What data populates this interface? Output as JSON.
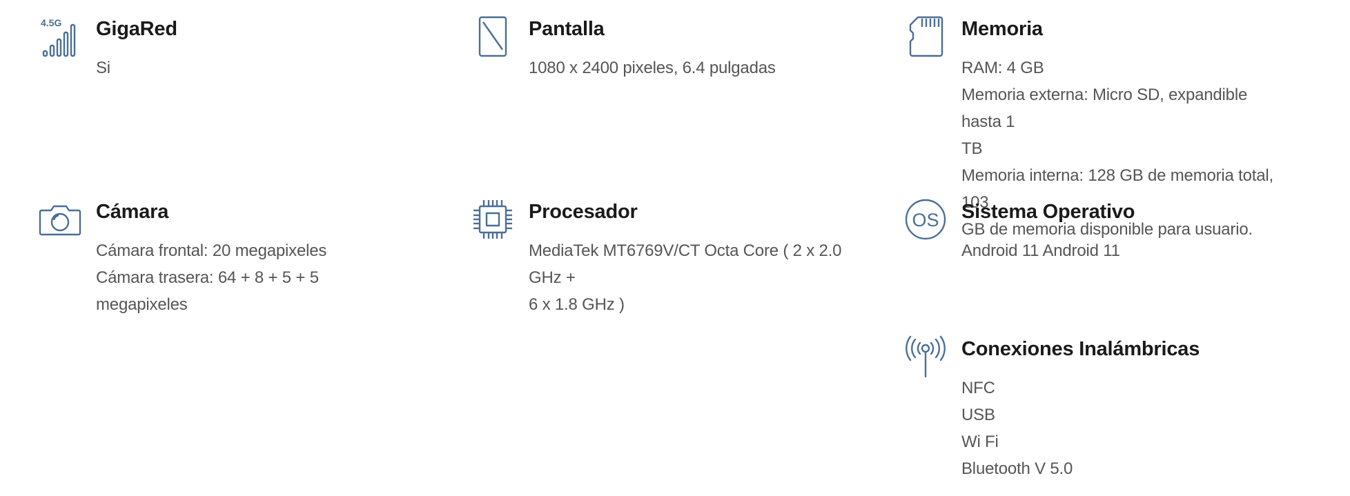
{
  "accent_color": "#4a6e96",
  "specs": [
    {
      "title": "GigaRed",
      "icon": "signal-4-5g-icon",
      "icon_text": "4.5G",
      "lines": [
        "Si"
      ]
    },
    {
      "title": "Pantalla",
      "icon": "screen-icon",
      "lines": [
        "1080 x 2400 pixeles, 6.4 pulgadas"
      ]
    },
    {
      "title": "Memoria",
      "icon": "sd-card-icon",
      "lines": [
        "RAM: 4 GB",
        "Memoria externa: Micro SD, expandible hasta 1",
        "TB",
        "Memoria interna: 128 GB de memoria total, 103",
        "GB de memoria disponible para usuario."
      ]
    },
    {
      "title": "Cámara",
      "icon": "camera-icon",
      "lines": [
        "Cámara frontal: 20 megapixeles",
        "Cámara trasera: 64 + 8 + 5 + 5 megapixeles"
      ]
    },
    {
      "title": "Procesador",
      "icon": "processor-chip-icon",
      "lines": [
        "MediaTek MT6769V/CT Octa Core ( 2 x 2.0 GHz +",
        "6 x 1.8 GHz )"
      ]
    },
    {
      "title": "Sistema Operativo",
      "icon": "os-icon",
      "icon_text": "OS",
      "lines": [
        "Android 11 Android 11"
      ]
    },
    {
      "title": "Conexiones Inalámbricas",
      "icon": "antenna-icon",
      "lines": [
        "NFC",
        "USB",
        "Wi Fi",
        "Bluetooth V 5.0"
      ]
    }
  ]
}
